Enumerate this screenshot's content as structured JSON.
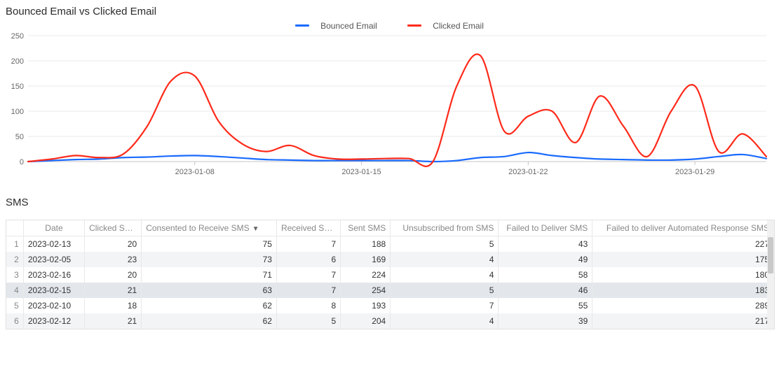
{
  "chart_title": "Bounced Email vs Clicked Email",
  "sms_title": "SMS",
  "legend": {
    "bounced": "Bounced Email",
    "clicked": "Clicked Email"
  },
  "colors": {
    "bounced": "#1a6bff",
    "clicked": "#ff2a1a",
    "grid": "#e8e8e8",
    "axis": "#c4c4c4",
    "tick": "#666666"
  },
  "chart_data": {
    "type": "line",
    "ylim": [
      0,
      250
    ],
    "yticks": [
      0,
      50,
      100,
      150,
      200,
      250
    ],
    "xlim_dates": [
      "2023-01-01",
      "2023-02-01"
    ],
    "xtick_labels": [
      "2023-01-08",
      "2023-01-15",
      "2023-01-22",
      "2023-01-29"
    ],
    "xtick_positions_days_from_start": [
      7,
      14,
      21,
      28
    ],
    "series": [
      {
        "name": "Bounced Email",
        "color": "#1a6bff",
        "values": [
          0,
          2,
          4,
          5,
          8,
          9,
          11,
          12,
          10,
          7,
          4,
          3,
          2,
          2,
          2,
          2,
          2,
          0,
          2,
          8,
          10,
          18,
          12,
          8,
          5,
          4,
          3,
          3,
          5,
          10,
          14,
          6
        ]
      },
      {
        "name": "Clicked Email",
        "color": "#ff2a1a",
        "values": [
          0,
          5,
          12,
          8,
          15,
          70,
          160,
          170,
          80,
          35,
          20,
          32,
          12,
          5,
          5,
          6,
          6,
          0,
          150,
          210,
          60,
          90,
          100,
          38,
          130,
          70,
          10,
          100,
          150,
          20,
          55,
          10
        ]
      }
    ],
    "x_start_date": "2023-01-01",
    "x_step_days": 1
  },
  "table": {
    "columns": [
      {
        "key": "idx",
        "label": ""
      },
      {
        "key": "date",
        "label": "Date"
      },
      {
        "key": "clicked",
        "label": "Clicked SMS"
      },
      {
        "key": "consent",
        "label": "Consented to Receive SMS",
        "sorted": "desc"
      },
      {
        "key": "received",
        "label": "Received SMS"
      },
      {
        "key": "sent",
        "label": "Sent SMS"
      },
      {
        "key": "unsub",
        "label": "Unsubscribed from SMS"
      },
      {
        "key": "fail",
        "label": "Failed to Deliver SMS"
      },
      {
        "key": "failauto",
        "label": "Failed to deliver Automated Response SMS"
      }
    ],
    "rows": [
      {
        "idx": 1,
        "date": "2023-02-13",
        "clicked": 20,
        "consent": 75,
        "received": 7,
        "sent": 188,
        "unsub": 5,
        "fail": 43,
        "failauto": 227
      },
      {
        "idx": 2,
        "date": "2023-02-05",
        "clicked": 23,
        "consent": 73,
        "received": 6,
        "sent": 169,
        "unsub": 4,
        "fail": 49,
        "failauto": 175
      },
      {
        "idx": 3,
        "date": "2023-02-16",
        "clicked": 20,
        "consent": 71,
        "received": 7,
        "sent": 224,
        "unsub": 4,
        "fail": 58,
        "failauto": 180
      },
      {
        "idx": 4,
        "date": "2023-02-15",
        "clicked": 21,
        "consent": 63,
        "received": 7,
        "sent": 254,
        "unsub": 5,
        "fail": 46,
        "failauto": 183
      },
      {
        "idx": 5,
        "date": "2023-02-10",
        "clicked": 18,
        "consent": 62,
        "received": 8,
        "sent": 193,
        "unsub": 7,
        "fail": 55,
        "failauto": 289
      },
      {
        "idx": 6,
        "date": "2023-02-12",
        "clicked": 21,
        "consent": 62,
        "received": 5,
        "sent": 204,
        "unsub": 4,
        "fail": 39,
        "failauto": 217
      }
    ]
  }
}
